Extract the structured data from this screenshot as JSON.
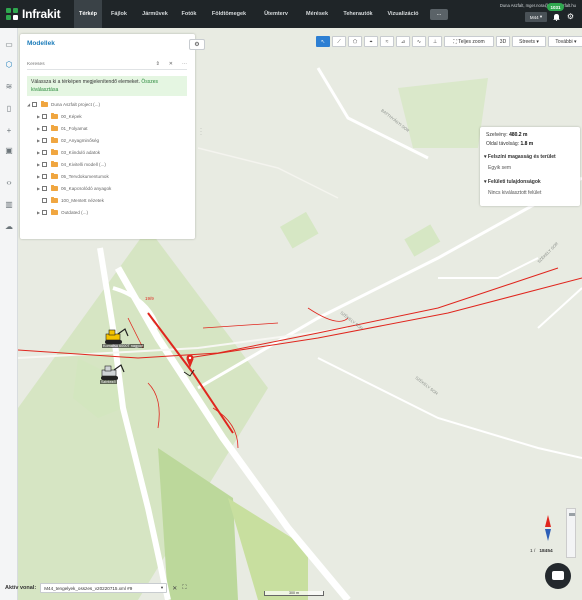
{
  "app": {
    "logo_text": "Infrakit",
    "user_email": "Duna Aszfalt, mger.nora@dunaaszfalt.hu",
    "project_code": "M44",
    "notification_count": "1031"
  },
  "nav": {
    "tabs": [
      "Térkép",
      "Fájlok",
      "Járművek",
      "Fotók",
      "Földtömegek",
      "Ütemterv",
      "Mérések",
      "Teherautók",
      "Vizualizáció"
    ],
    "active_tab": "Térkép",
    "more_label": "..."
  },
  "panel": {
    "title": "Modellek",
    "search_placeholder": "Keresés",
    "hint_text": "Válassza ki a térképen megjelenítendő elemeket.",
    "hint_link": "Összes kiválasztása",
    "tree": [
      {
        "label": "Duna Aszfalt project (...)",
        "level": 0
      },
      {
        "label": "00_Képek",
        "level": 1
      },
      {
        "label": "01_Folyamat",
        "level": 1
      },
      {
        "label": "02_Anyagminőség",
        "level": 1
      },
      {
        "label": "03_Kiinduló adatok",
        "level": 1
      },
      {
        "label": "04_Kivitelli modell (...)",
        "level": 1
      },
      {
        "label": "05_Tervdokumentumok",
        "level": 1
      },
      {
        "label": "06_Kapcsolódó anyagok",
        "level": 1
      },
      {
        "label": "100_Mentett nézetek",
        "level": 1
      },
      {
        "label": "Outdated (...)",
        "level": 1
      }
    ]
  },
  "map_toolbar": {
    "fullscreen_label": "Teljes zoom",
    "view_3d_label": "3D",
    "streets_label": "Streets",
    "more_label": "További"
  },
  "info_box": {
    "width_label": "Szelvény:",
    "width_value": "480.2 m",
    "offset_label": "Oldal távolság:",
    "offset_value": "1.8 m",
    "section1_title": "Felszíni magasság és terület",
    "section1_value": "Egyik sem",
    "section2_title": "Felületi tulajdonságok",
    "section2_value": "Nincs kiválasztott felület"
  },
  "map_labels": {
    "road1": "BATTHYÁNYI SOR",
    "road2": "SZÉKELY SOR",
    "road3": "SZÉKELY SOR",
    "road4": "SZÉKELY SOR",
    "machine1": "Komatsu 6000T nagyon",
    "machine2": "Szintező",
    "red_marker_label": "19/9"
  },
  "bottom": {
    "active_label": "Aktív vonal:",
    "active_value": "M44_tengelyek_osszes_v20220715.xml #9",
    "scale_label": "300 m",
    "zoom_index": "1 /",
    "zoom_value": "18454"
  },
  "colors": {
    "nav_bg": "#1f2528",
    "accent": "#2d7fd3",
    "brand_green": "#2fa84f",
    "road_red": "#e0261e"
  }
}
